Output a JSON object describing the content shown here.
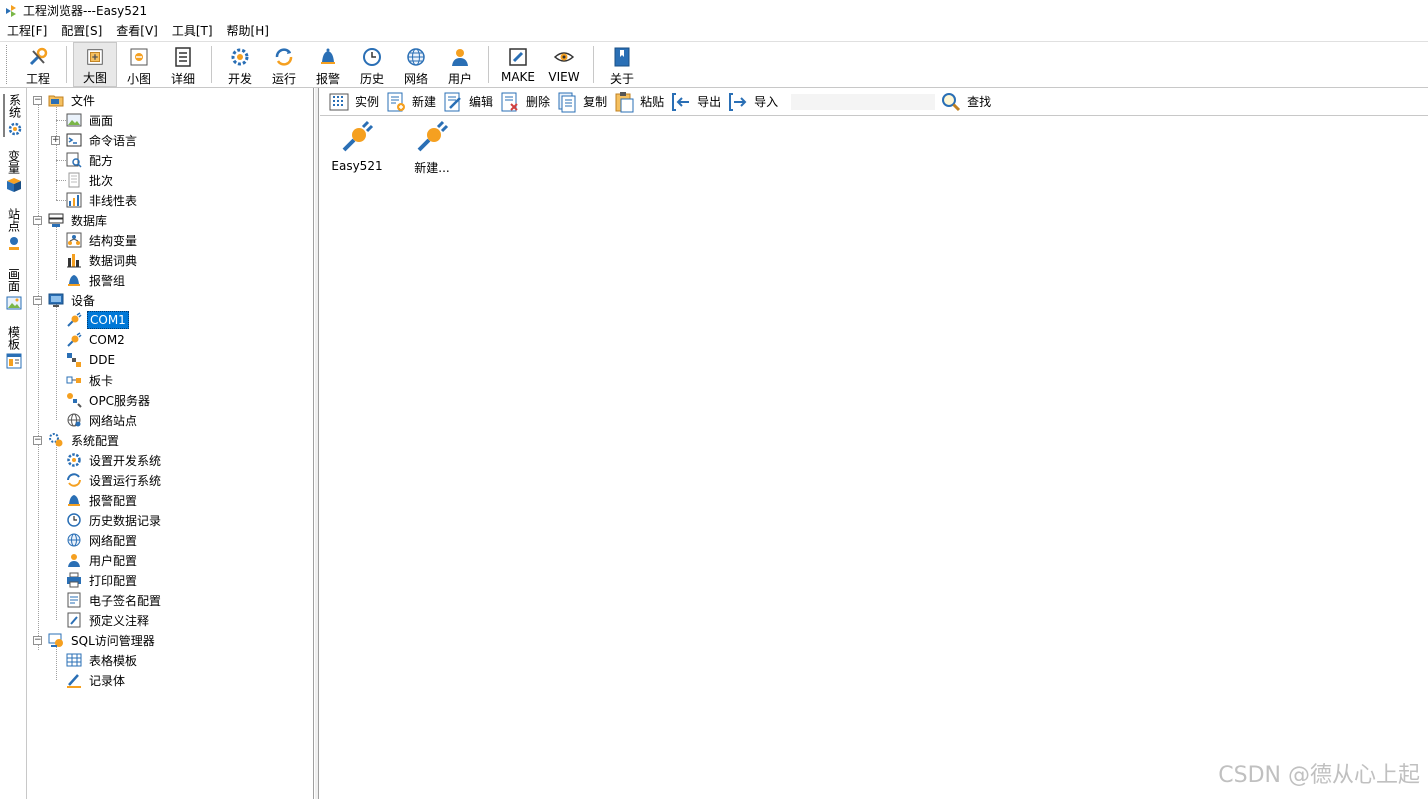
{
  "window": {
    "title": "工程浏览器---Easy521"
  },
  "menu": [
    "工程[F]",
    "配置[S]",
    "查看[V]",
    "工具[T]",
    "帮助[H]"
  ],
  "toolbar": {
    "project": "工程",
    "big_view": "大图",
    "small_view": "小图",
    "detail_view": "详细",
    "develop": "开发",
    "run": "运行",
    "alarm": "报警",
    "history": "历史",
    "network": "网络",
    "user": "用户",
    "make": "MAKE",
    "view": "VIEW",
    "about": "关于"
  },
  "side_tabs": [
    "系统",
    "变量",
    "站点",
    "画面",
    "模板"
  ],
  "tree": {
    "file": "文件",
    "screen": "画面",
    "command_language": "命令语言",
    "recipe": "配方",
    "batch": "批次",
    "nonlinear_table": "非线性表",
    "database": "数据库",
    "struct_var": "结构变量",
    "data_dict": "数据词典",
    "alarm_group": "报警组",
    "device": "设备",
    "com1": "COM1",
    "com2": "COM2",
    "dde": "DDE",
    "board": "板卡",
    "opc_server": "OPC服务器",
    "net_station": "网络站点",
    "sys_config": "系统配置",
    "set_dev_sys": "设置开发系统",
    "set_run_sys": "设置运行系统",
    "alarm_config": "报警配置",
    "history_record": "历史数据记录",
    "network_config": "网络配置",
    "user_config": "用户配置",
    "print_config": "打印配置",
    "esign_config": "电子签名配置",
    "predefined_notes": "预定义注释",
    "sql_manager": "SQL访问管理器",
    "table_template": "表格模板",
    "record_body": "记录体"
  },
  "content_toolbar": {
    "instance": "实例",
    "new": "新建",
    "edit": "编辑",
    "delete": "删除",
    "copy": "复制",
    "paste": "粘贴",
    "export": "导出",
    "import": "导入",
    "search_value": "",
    "find": "查找"
  },
  "items": [
    "Easy521",
    "新建..."
  ],
  "watermark": "CSDN @德从心上起",
  "colors": {
    "selection": "#0078d7",
    "accent_orange": "#f5a020",
    "accent_blue": "#2a6fb5"
  }
}
